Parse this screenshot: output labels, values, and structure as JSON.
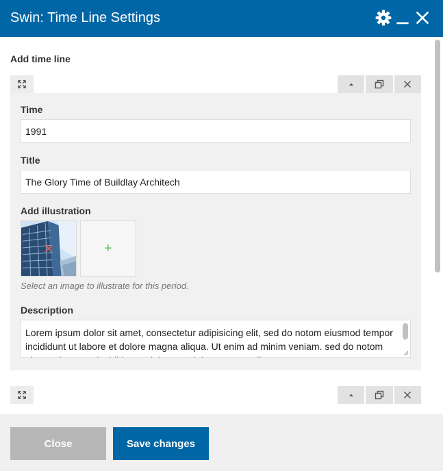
{
  "window": {
    "title": "Swin: Time Line Settings",
    "icons": [
      "gear-icon",
      "minimize-icon",
      "close-icon"
    ]
  },
  "section": {
    "title": "Add time line"
  },
  "timeline_item": {
    "time_label": "Time",
    "time_value": "1991",
    "title_label": "Title",
    "title_value": "The Glory Time of Buildlay Architech",
    "illustration_label": "Add illustration",
    "add_symbol": "+",
    "illustration_hint": "Select an image to illustrate for this period.",
    "description_label": "Description",
    "description_value": "Lorem ipsum dolor sit amet, consectetur adipisicing elit, sed do notom eiusmod tempor incididunt ut labore et dolore magna aliqua. Ut enim ad minim veniam. sed do notom eiusmod tempor incididunt ut labore et dolore magna aliqua."
  },
  "footer": {
    "close_label": "Close",
    "save_label": "Save changes"
  },
  "colors": {
    "header_bg": "#0066a6",
    "save_bg": "#0066a6",
    "close_bg": "#b7b7b7",
    "panel_bg": "#f1f1f1",
    "remove_x": "#e05a5a",
    "add_plus": "#60c060"
  }
}
